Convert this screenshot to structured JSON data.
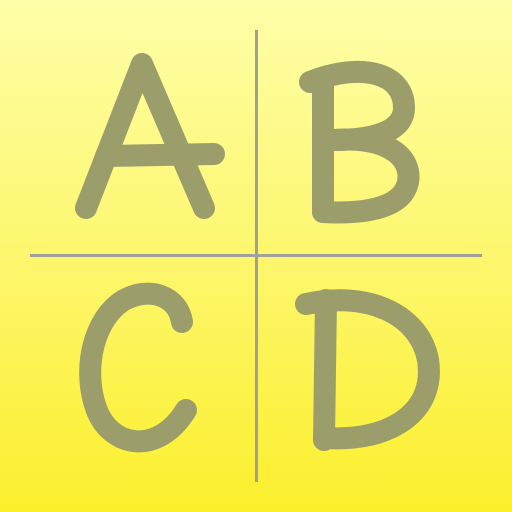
{
  "tiles": [
    {
      "letter": "A",
      "position": "top-left"
    },
    {
      "letter": "B",
      "position": "top-right"
    },
    {
      "letter": "C",
      "position": "bottom-left"
    },
    {
      "letter": "D",
      "position": "bottom-right"
    }
  ],
  "colors": {
    "letter": "#9b9e6b",
    "divider": "#a0a09a",
    "background_top": "#fefea8",
    "background_bottom": "#fbef2c"
  }
}
